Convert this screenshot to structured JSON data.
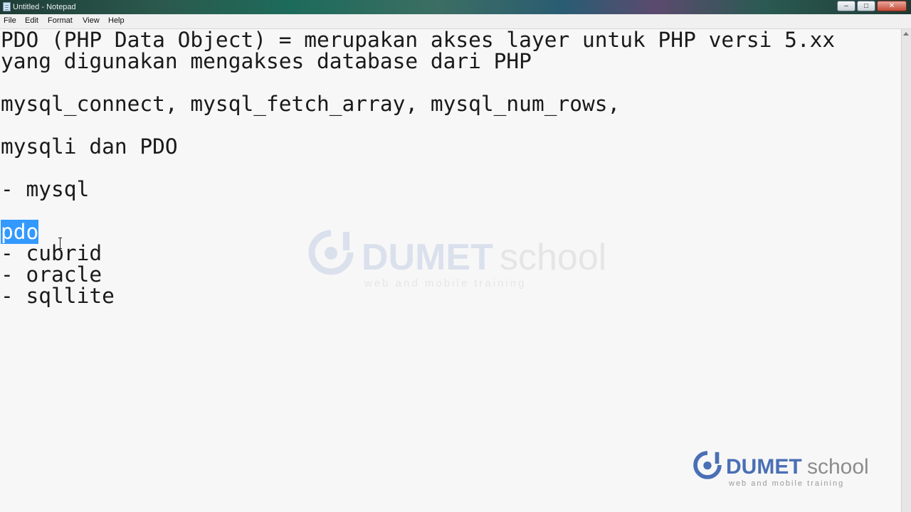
{
  "window": {
    "title": "Untitled - Notepad",
    "minimize_glyph": "–",
    "maximize_glyph": "□",
    "close_glyph": "✕"
  },
  "menu": {
    "file": "File",
    "edit": "Edit",
    "format": "Format",
    "view": "View",
    "help": "Help"
  },
  "editor": {
    "lines": [
      "PDO (PHP Data Object) = merupakan akses layer untuk PHP versi 5.xx",
      "yang digunakan mengakses database dari PHP",
      "",
      "mysql_connect, mysql_fetch_array, mysql_num_rows,",
      "",
      "mysqli dan PDO",
      "",
      "- mysql",
      "",
      "pdo",
      "- cubrid",
      "- oracle",
      "- sqllite"
    ],
    "selected_text": "pdo"
  },
  "watermark": {
    "brand_bold": "DUMET",
    "brand_light": "school",
    "tagline": "web and mobile training",
    "colors": {
      "blue": "#4a6fb5",
      "gray": "#8c8c8c"
    }
  }
}
